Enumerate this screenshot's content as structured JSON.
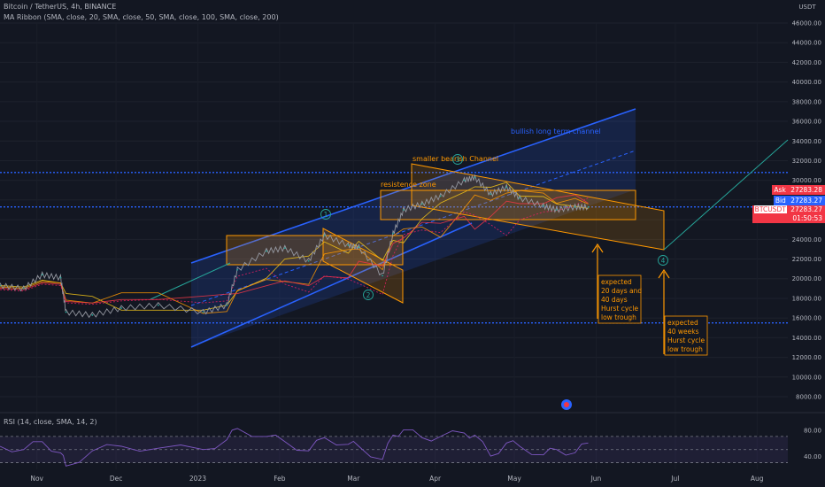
{
  "header": {
    "line1": "Bitcoin / TetherUS, 4h, BINANCE",
    "line2": "MA Ribbon (SMA, close, 20, SMA, close, 50, SMA, close, 100, SMA, close, 200)"
  },
  "axis": {
    "unit": "USDT",
    "ticks": [
      "46000.00",
      "44000.00",
      "42000.00",
      "40000.00",
      "38000.00",
      "36000.00",
      "34000.00",
      "32000.00",
      "30000.00",
      "28000.00",
      "26000.00",
      "24000.00",
      "22000.00",
      "20000.00",
      "18000.00",
      "16000.00",
      "14000.00",
      "12000.00",
      "10000.00",
      "8000.00"
    ],
    "tick_values": [
      46000,
      44000,
      42000,
      40000,
      38000,
      36000,
      34000,
      32000,
      30000,
      28000,
      26000,
      24000,
      22000,
      20000,
      18000,
      16000,
      14000,
      12000,
      10000,
      8000
    ]
  },
  "x_axis": {
    "labels": [
      "Nov",
      "Dec",
      "2023",
      "Feb",
      "Mar",
      "Apr",
      "May",
      "Jun",
      "Jul",
      "Aug"
    ]
  },
  "price_labels": {
    "ask_tag": "Ask",
    "ask": "27283.28",
    "bid_tag": "Bid",
    "bid": "27283.27",
    "symbol": "BTCUSDT",
    "last": "27283.27",
    "countdown": "01:50:53"
  },
  "annotations": {
    "channel_long": "bullish long term channel",
    "channel_small": "smaller bearish Channel",
    "resistance": "resistence zone",
    "wave1": "1",
    "wave2": "2",
    "wave3": "3",
    "wave4": "4",
    "box1": [
      "expected",
      "20 days and",
      "40 days",
      "Hurst cycle",
      "low trough"
    ],
    "box2": [
      "expected",
      "40 weeks",
      "Hurst cycle",
      "low trough"
    ]
  },
  "rsi": {
    "label": "RSI (14, close, SMA, 14, 2)",
    "ticks": [
      "80.00",
      "40.00"
    ]
  },
  "chart_data": {
    "type": "line",
    "title": "Bitcoin / TetherUS, 4h, BINANCE",
    "xlabel": "",
    "ylabel": "USDT",
    "ylim": [
      7000,
      47000
    ],
    "x": [
      "Oct 16",
      "Oct 25",
      "Nov 1",
      "Nov 8",
      "Nov 10",
      "Nov 20",
      "Dec 1",
      "Dec 15",
      "Jan 1",
      "Jan 10",
      "Jan 14",
      "Jan 25",
      "Feb 1",
      "Feb 10",
      "Feb 16",
      "Feb 25",
      "Mar 1",
      "Mar 10",
      "Mar 14",
      "Mar 18",
      "Mar 25",
      "Apr 1",
      "Apr 10",
      "Apr 14",
      "Apr 20",
      "Apr 26",
      "May 1",
      "May 10",
      "May 15",
      "May 22",
      "May 27"
    ],
    "series": [
      {
        "values": [
          19300,
          19000,
          20400,
          20100,
          16600,
          16300,
          17000,
          17300,
          16600,
          17300,
          20900,
          22800,
          23100,
          21800,
          24400,
          23400,
          23200,
          20300,
          24600,
          27000,
          27600,
          28400,
          30000,
          30300,
          28600,
          29300,
          28200,
          27400,
          27000,
          27300,
          27283
        ]
      }
    ],
    "levels": [
      30800,
      27300,
      15500
    ],
    "rsi": {
      "ylim": [
        20,
        90
      ],
      "levels": [
        70,
        50,
        30
      ],
      "values": [
        55,
        50,
        62,
        45,
        25,
        48,
        55,
        52,
        50,
        65,
        82,
        70,
        62,
        48,
        68,
        58,
        55,
        35,
        72,
        80,
        68,
        70,
        75,
        72,
        40,
        60,
        55,
        42,
        50,
        45,
        60
      ]
    }
  }
}
